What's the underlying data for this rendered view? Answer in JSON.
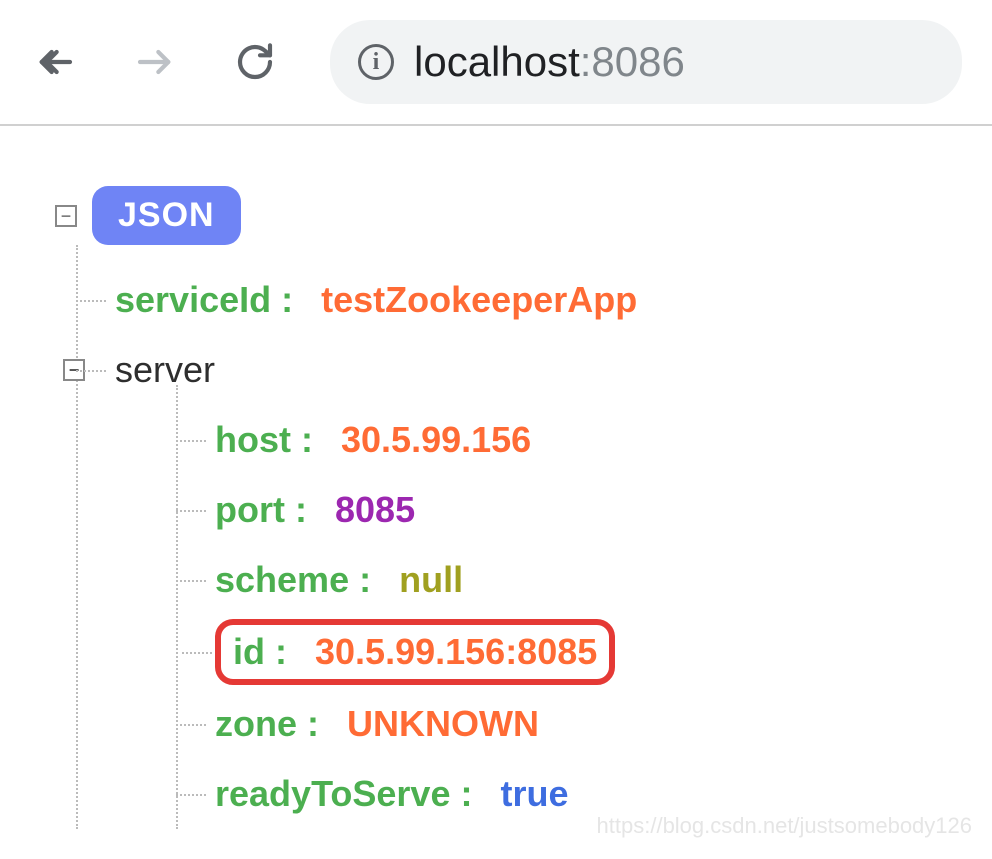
{
  "browser": {
    "url_host": "localhost",
    "url_port": ":8086"
  },
  "json_viewer": {
    "root_label": "JSON",
    "items": {
      "serviceId": {
        "key": "serviceId",
        "value": "testZookeeperApp"
      },
      "server": {
        "key": "server",
        "children": {
          "host": {
            "key": "host",
            "value": "30.5.99.156"
          },
          "port": {
            "key": "port",
            "value": "8085"
          },
          "scheme": {
            "key": "scheme",
            "value": "null"
          },
          "id": {
            "key": "id",
            "value": "30.5.99.156:8085"
          },
          "zone": {
            "key": "zone",
            "value": "UNKNOWN"
          },
          "readyToServe": {
            "key": "readyToServe",
            "value": "true"
          }
        }
      }
    }
  },
  "watermark": "https://blog.csdn.net/justsomebody126"
}
